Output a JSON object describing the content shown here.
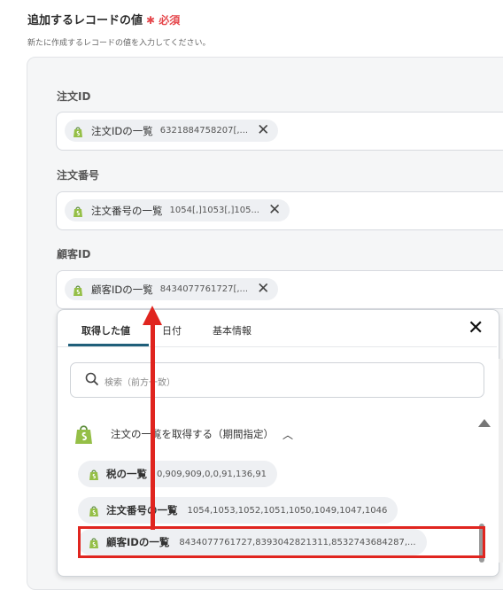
{
  "section": {
    "title": "追加するレコードの値",
    "required_mark": "✱ 必須",
    "subtitle": "新たに作成するレコードの値を入力してください。"
  },
  "fields": [
    {
      "label": "注文ID",
      "chip_name": "注文IDの一覧",
      "chip_value": "6321884758207[,...",
      "remove": "✕"
    },
    {
      "label": "注文番号",
      "chip_name": "注文番号の一覧",
      "chip_value": "1054[,]1053[,]105...",
      "remove": "✕"
    },
    {
      "label": "顧客ID",
      "chip_name": "顧客IDの一覧",
      "chip_value": "8434077761727[,...",
      "remove": "✕"
    }
  ],
  "dropdown": {
    "tabs": [
      "取得した値",
      "日付",
      "基本情報"
    ],
    "active_tab": "取得した値",
    "close": "✕",
    "search_placeholder": "検索（前方一致）",
    "group_title": "注文の一覧を取得する（期間指定）",
    "group_toggle": "︿",
    "items": [
      {
        "name": "税の一覧",
        "value": "0,909,909,0,0,91,136,91"
      },
      {
        "name": "注文番号の一覧",
        "value": "1054,1053,1052,1051,1050,1049,1047,1046"
      },
      {
        "name": "顧客IDの一覧",
        "value": "8434077761727,8393042821311,8532743684287,..."
      }
    ]
  },
  "colors": {
    "accent_red": "#e0251f",
    "shopify_green": "#95bf47",
    "tab_underline": "#1f5f7a"
  },
  "icons": [
    "shopify-icon",
    "search-icon",
    "close-icon",
    "chevron-up-icon"
  ]
}
